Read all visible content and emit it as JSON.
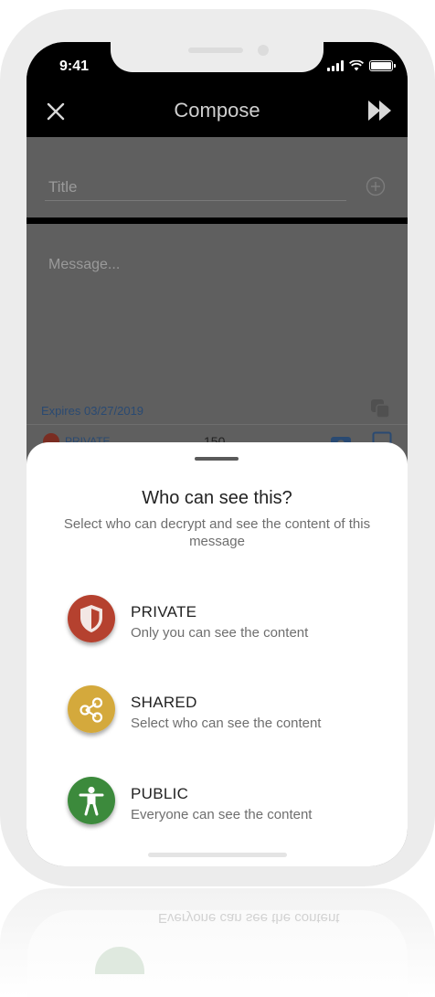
{
  "status_bar": {
    "time": "9:41"
  },
  "app_bar": {
    "title": "Compose"
  },
  "compose": {
    "title_placeholder": "Title",
    "message_placeholder": "Message...",
    "expires": "Expires 03/27/2019",
    "privacy_label": "PRIVATE",
    "char_count": "150"
  },
  "sheet": {
    "title": "Who can see this?",
    "subtitle": "Select who can decrypt and see the content of this message",
    "options": [
      {
        "label": "PRIVATE",
        "description": "Only you can see the content",
        "icon": "shield-icon",
        "color": "#b5412f"
      },
      {
        "label": "SHARED",
        "description": "Select who can see the content",
        "icon": "share-icon",
        "color": "#d4a93c"
      },
      {
        "label": "PUBLIC",
        "description": "Everyone can see the content",
        "icon": "person-icon",
        "color": "#3c8a3c"
      }
    ]
  },
  "reflection": {
    "text": "Everyone can see the content"
  },
  "colors": {
    "screen_dim": "#5f5f5f",
    "app_bar": "#000000",
    "link_blue": "#2a4a72"
  }
}
